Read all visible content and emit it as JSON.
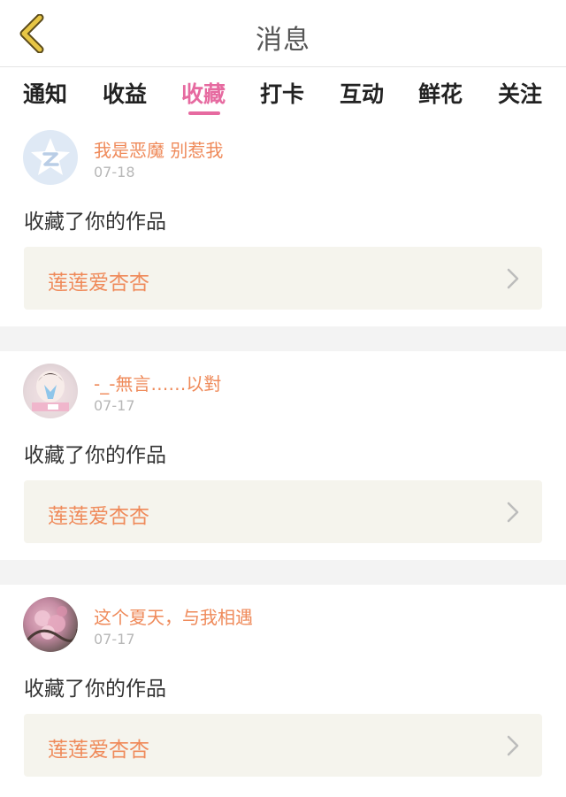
{
  "header": {
    "title": "消息"
  },
  "tabs": [
    {
      "label": "通知",
      "active": false
    },
    {
      "label": "收益",
      "active": false
    },
    {
      "label": "收藏",
      "active": true
    },
    {
      "label": "打卡",
      "active": false
    },
    {
      "label": "互动",
      "active": false
    },
    {
      "label": "鲜花",
      "active": false
    },
    {
      "label": "关注",
      "active": false
    }
  ],
  "items": [
    {
      "username": "我是恶魔 别惹我",
      "date": "07-18",
      "action": "收藏了你的作品",
      "work_title": "莲莲爱杏杏",
      "avatar": "qq-default-avatar"
    },
    {
      "username": "-_-無言……以對",
      "date": "07-17",
      "action": "收藏了你的作品",
      "work_title": "莲莲爱杏杏",
      "avatar": "user-photo-avatar"
    },
    {
      "username": "这个夏天，与我相遇",
      "date": "07-17",
      "action": "收藏了你的作品",
      "work_title": "莲莲爱杏杏",
      "avatar": "flower-photo-avatar"
    }
  ],
  "colors": {
    "accent": "#e66aa0",
    "username": "#ef8a5a",
    "back_arrow": "#e7c645"
  }
}
